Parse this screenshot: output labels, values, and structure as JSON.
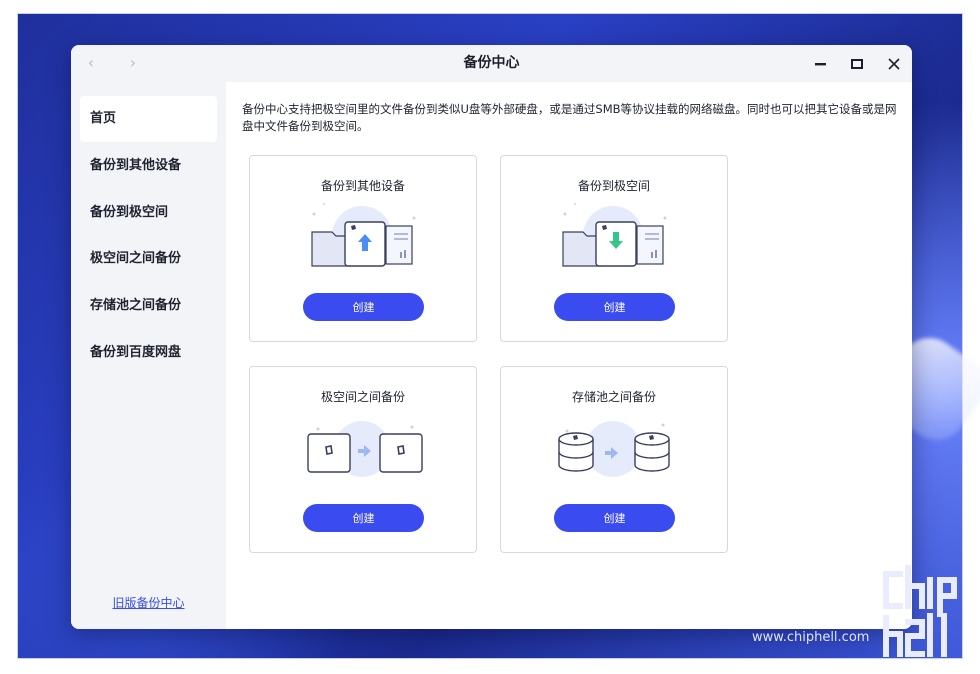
{
  "window": {
    "title": "备份中心"
  },
  "sidebar": {
    "items": [
      {
        "label": "首页",
        "active": true
      },
      {
        "label": "备份到其他设备",
        "active": false
      },
      {
        "label": "备份到极空间",
        "active": false
      },
      {
        "label": "极空间之间备份",
        "active": false
      },
      {
        "label": "存储池之间备份",
        "active": false
      },
      {
        "label": "备份到百度网盘",
        "active": false
      }
    ],
    "old_link": "旧版备份中心"
  },
  "main": {
    "description": "备份中心支持把极空间里的文件备份到类似U盘等外部硬盘，或是通过SMB等协议挂载的网络磁盘。同时也可以把其它设备或是网盘中文件备份到极空间。",
    "cards": [
      {
        "title": "备份到其他设备",
        "button": "创建",
        "icon": "upload-to-device-illustration"
      },
      {
        "title": "备份到极空间",
        "button": "创建",
        "icon": "download-to-zspace-illustration"
      },
      {
        "title": "极空间之间备份",
        "button": "创建",
        "icon": "device-to-device-illustration"
      },
      {
        "title": "存储池之间备份",
        "button": "创建",
        "icon": "pool-to-pool-illustration"
      }
    ]
  },
  "watermark": {
    "url": "www.chiphell.com"
  },
  "colors": {
    "accent": "#3a4bf0",
    "link": "#3a4fe6",
    "sidebar_bg": "#f3f4f8"
  }
}
